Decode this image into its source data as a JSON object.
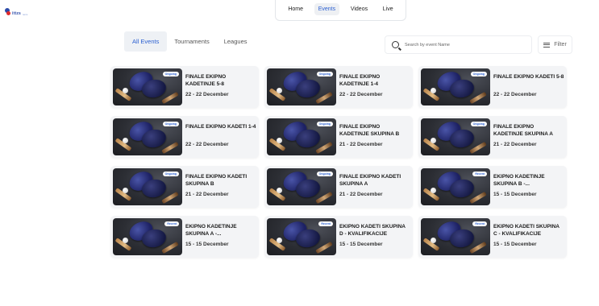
{
  "logo": {
    "text": "ittzs",
    "sub": "tenis"
  },
  "nav": [
    "Home",
    "Events",
    "Videos",
    "Live"
  ],
  "nav_active": 1,
  "tabs": [
    "All Events",
    "Tournaments",
    "Leagues"
  ],
  "tab_active": 0,
  "search": {
    "placeholder": "Search by event Name"
  },
  "filter": {
    "label": "Filter"
  },
  "events": [
    {
      "title": "FINALE EKIPNO KADETINJE 5-8",
      "date": "22 - 22 December",
      "status": "Ongoing"
    },
    {
      "title": "FINALE EKIPNO KADETINJE 1-4",
      "date": "22 - 22 December",
      "status": "Ongoing"
    },
    {
      "title": "FINALE EKIPNO KADETI 5-8",
      "date": "22 - 22 December",
      "status": "Ongoing"
    },
    {
      "title": "FINALE EKIPNO KADETI 1-4",
      "date": "22 - 22 December",
      "status": "Ongoing"
    },
    {
      "title": "FINALE EKIPNO KADETINJE SKUPINA B",
      "date": "21 - 22 December",
      "status": "Ongoing"
    },
    {
      "title": "FINALE EKIPNO KADETINJE SKUPINA A",
      "date": "21 - 22 December",
      "status": "Ongoing"
    },
    {
      "title": "FINALE EKIPNO KADETI SKUPINA B",
      "date": "21 - 22 December",
      "status": "Ongoing"
    },
    {
      "title": "FINALE EKIPNO KADETI SKUPINA A",
      "date": "21 - 22 December",
      "status": "Ongoing"
    },
    {
      "title": "EKIPNO KADETINJE SKUPINA B -...",
      "date": "15 - 15 December",
      "status": "Recent"
    },
    {
      "title": "EKIPNO KADETINJE SKUPINA A -...",
      "date": "15 - 15 December",
      "status": "Recent"
    },
    {
      "title": "EKIPNO KADETI SKUPINA D - KVALIFIKACIJE",
      "date": "15 - 15 December",
      "status": "Recent"
    },
    {
      "title": "EKIPNO KADETI SKUPINA C - KVALIFIKACIJE",
      "date": "15 - 15 December",
      "status": "Recent"
    }
  ]
}
